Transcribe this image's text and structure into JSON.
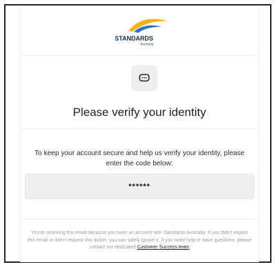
{
  "brand": {
    "name": "STANDARDS",
    "subname": "Australia",
    "colors": {
      "swoosh_yellow": "#f2b21b",
      "swoosh_blue": "#2f76bd",
      "text": "#1a2b4a"
    }
  },
  "icon": {
    "name": "chat-bubble-icon"
  },
  "title": "Please verify your identity",
  "message": "To keep your account secure and help us verify your identity, please enter the code below:",
  "code": "******",
  "footer": {
    "text": "You're receiving this email because you have an account with Standards Australia. If you didn't expect this email or didn't request this action, you can safely ignore it. If you need help or have questions, please contact our dedicated",
    "link": "Customer Success team"
  }
}
